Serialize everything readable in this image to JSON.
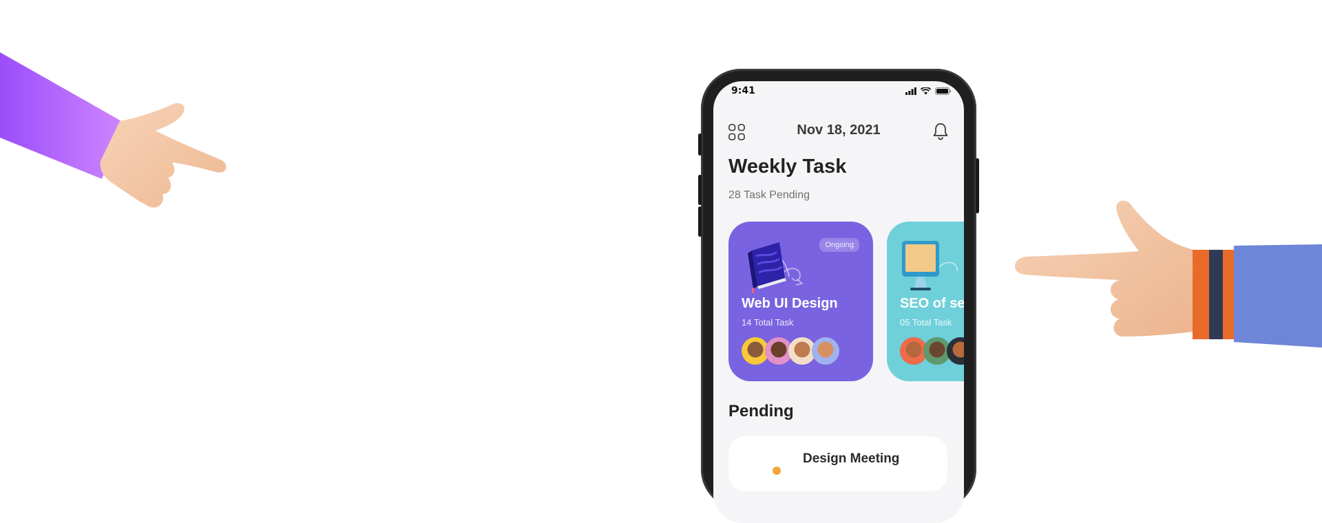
{
  "status_bar": {
    "time": "9:41"
  },
  "header": {
    "date": "Nov 18, 2021",
    "menu_icon": "grid-menu-icon",
    "bell_icon": "bell-icon"
  },
  "weekly": {
    "title": "Weekly Task",
    "subtitle": "28 Task Pending"
  },
  "cards": [
    {
      "title": "Web UI Design",
      "subtitle": "14 Total Task",
      "badge": "Ongoing",
      "color": "#7a63e0",
      "illustration": "book-icon"
    },
    {
      "title": "SEO of ser",
      "subtitle": "05 Total Task",
      "color": "#6fd0da",
      "illustration": "monitor-icon"
    }
  ],
  "pending": {
    "title": "Pending",
    "items": [
      {
        "title": "Design Meeting"
      }
    ]
  },
  "colors": {
    "accent_purple": "#7a63e0",
    "accent_cyan": "#6fd0da",
    "phone_frame": "#1f1f1f"
  }
}
